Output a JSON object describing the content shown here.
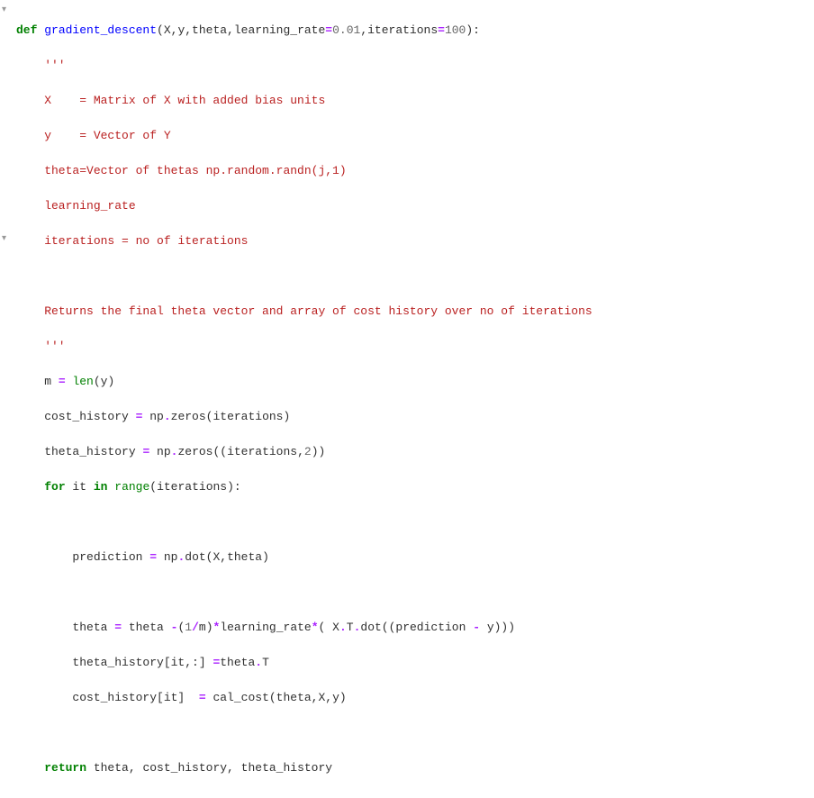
{
  "fold_markers": {
    "top": "▾",
    "loop": "▾"
  },
  "code": {
    "l1": {
      "def": "def",
      "name": "gradient_descent",
      "params": "(X,y,theta,learning_rate",
      "eq1": "=",
      "v1": "0.01",
      "comma": ",iterations",
      "eq2": "=",
      "v2": "100",
      "close": "):"
    },
    "l2": "    '''",
    "l3": "    X    = Matrix of X with added bias units",
    "l4": "    y    = Vector of Y",
    "l5": "    theta=Vector of thetas np.random.randn(j,1)",
    "l6": "    learning_rate",
    "l7": "    iterations = no of iterations",
    "l8": "    ",
    "l9": "    Returns the final theta vector and array of cost history over no of iterations",
    "l10": "    '''",
    "l11": {
      "pre": "    m ",
      "op": "=",
      "sp": " ",
      "len": "len",
      "post": "(y)"
    },
    "l12": {
      "pre": "    cost_history ",
      "op": "=",
      "post": " np",
      "dot": ".",
      "zeros": "zeros(iterations)"
    },
    "l13": {
      "pre": "    theta_history ",
      "op": "=",
      "post": " np",
      "dot": ".",
      "zeros": "zeros((iterations,",
      "num": "2",
      "close": "))"
    },
    "l14": {
      "indent": "    ",
      "for": "for",
      "it": " it ",
      "in": "in",
      "sp": " ",
      "range": "range",
      "post": "(iterations):"
    },
    "l15": "        ",
    "l16": {
      "pre": "        prediction ",
      "op": "=",
      "post": " np",
      "dot": ".",
      "call": "dot(X,theta)"
    },
    "l17": "        ",
    "l18": {
      "pre": "        theta ",
      "op1": "=",
      "mid": " theta ",
      "op2": "-",
      "open": "(",
      "one": "1",
      "slash": "/",
      "m": "m)",
      "op3": "*",
      "lr": "learning_rate",
      "op4": "*",
      "rest": "( X",
      "dot2": ".",
      "t": "T",
      "dot3": ".",
      "call": "dot((prediction ",
      "op5": "-",
      "end": " y)))"
    },
    "l19": {
      "pre": "        theta_history[it,:] ",
      "op": "=",
      "post": "theta",
      "dot": ".",
      "t": "T"
    },
    "l20": {
      "pre": "        cost_history[it]  ",
      "op": "=",
      "post": " cal_cost(theta,X,y)"
    },
    "l21": "        ",
    "l22": {
      "indent": "    ",
      "return": "return",
      "post": " theta, cost_history, theta_history"
    }
  }
}
